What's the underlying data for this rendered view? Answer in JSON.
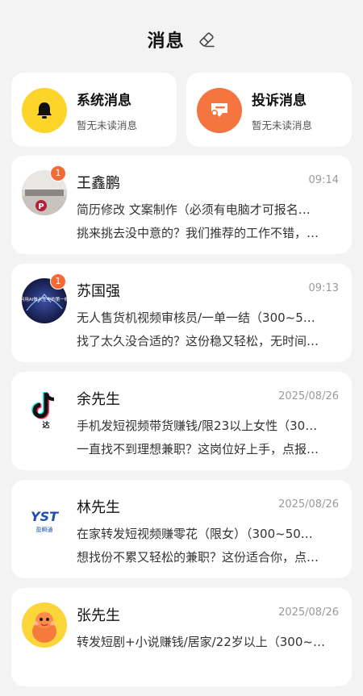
{
  "header": {
    "title": "消息",
    "clear_icon": "eraser-icon"
  },
  "categories": [
    {
      "title": "系统消息",
      "subtitle": "暂无未读消息",
      "icon": "bell-icon",
      "color": "#fcd42a"
    },
    {
      "title": "投诉消息",
      "subtitle": "暂无未读消息",
      "icon": "complaint-icon",
      "color": "#f47540"
    }
  ],
  "conversations": [
    {
      "name": "王鑫鹏",
      "time": "09:14",
      "badge": "1",
      "line1": "简历修改 文案制作（必须有电脑才可报名…",
      "line2": "挑来挑去没中意的？我们推荐的工作不错，…"
    },
    {
      "name": "苏国强",
      "time": "09:13",
      "badge": "1",
      "avatar_text": "如何用AI做人生中的第一桶金",
      "line1": "无人售货机视频审核员/一单一结（300~5…",
      "line2": "找了太久没合适的？这份稳又轻松，无时间…"
    },
    {
      "name": "余先生",
      "time": "2025/08/26",
      "avatar_text": "达",
      "line1": "手机发短视频带货赚钱/限23以上女性（30…",
      "line2": "一直找不到理想兼职？这岗位好上手，点报…"
    },
    {
      "name": "林先生",
      "time": "2025/08/26",
      "avatar_text": "YST",
      "avatar_sub": "盈瞬通",
      "line1": "在家转发短视频赚零花（限女）（300~50…",
      "line2": "想找份不累又轻松的兼职？这份适合你，点…"
    },
    {
      "name": "张先生",
      "time": "2025/08/26",
      "line1": "转发短剧+小说赚钱/居家/22岁以上（300~…",
      "line2": ""
    }
  ]
}
